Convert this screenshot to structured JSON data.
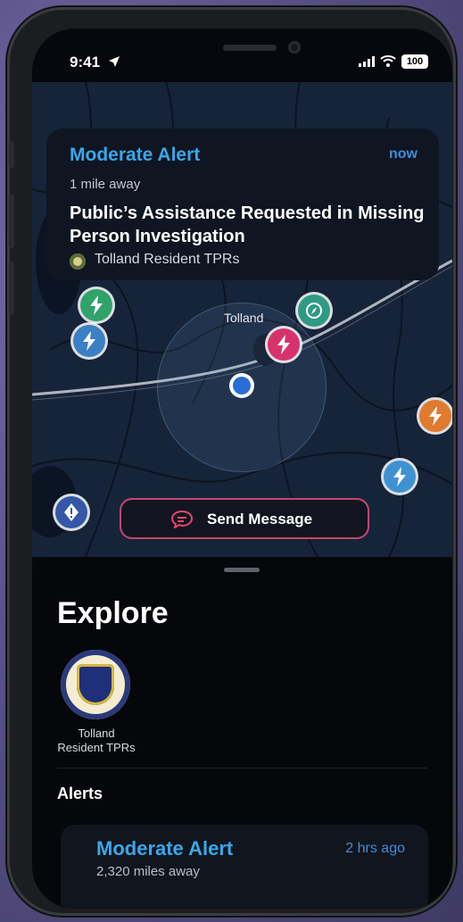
{
  "status_bar": {
    "time": "9:41",
    "battery": "100"
  },
  "notification": {
    "title": "Moderate Alert",
    "time": "now",
    "distance": "1 mile away",
    "headline": "Public’s Assistance Requested in Missing Person Investigation",
    "source": "Tolland Resident TPRs"
  },
  "map": {
    "town_label": "Tolland",
    "pins": [
      {
        "icon": "bolt-icon",
        "color": "#2fa36a"
      },
      {
        "icon": "bolt-icon",
        "color": "#3b7fc4"
      },
      {
        "icon": "compass-icon",
        "color": "#2f9a84"
      },
      {
        "icon": "bolt-icon",
        "color": "#d6336c"
      },
      {
        "icon": "bolt-icon",
        "color": "#e07a2f"
      },
      {
        "icon": "bolt-icon",
        "color": "#3f92d1"
      },
      {
        "icon": "warning-icon",
        "color": "#3458a8"
      }
    ],
    "send_message_label": "Send Message"
  },
  "explore": {
    "title": "Explore",
    "agencies": [
      {
        "name": "Tolland Resident TPRs"
      }
    ],
    "alerts_heading": "Alerts",
    "alerts": [
      {
        "title": "Moderate Alert",
        "time": "2 hrs ago",
        "distance": "2,320 miles away"
      }
    ]
  },
  "colors": {
    "alert_blue": "#38a8ea",
    "accent_pink": "#c4466f"
  }
}
